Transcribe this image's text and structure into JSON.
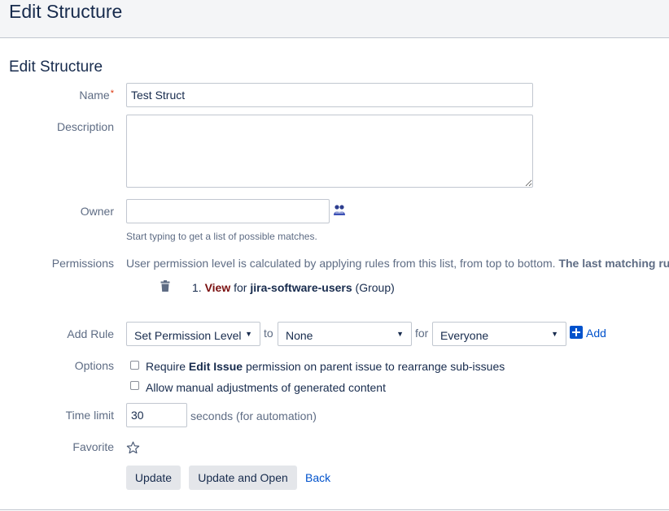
{
  "header": {
    "title": "Edit Structure"
  },
  "form": {
    "title": "Edit Structure",
    "name": {
      "label": "Name",
      "required_mark": "*",
      "value": "Test Struct"
    },
    "description": {
      "label": "Description",
      "value": ""
    },
    "owner": {
      "label": "Owner",
      "value": "",
      "hint": "Start typing to get a list of possible matches."
    },
    "permissions": {
      "label": "Permissions",
      "intro": "User permission level is calculated by applying rules from this list, from top to bottom. ",
      "intro_bold": "The last matching ru",
      "rules": [
        {
          "number": "1.",
          "level": "View",
          "for_text": " for ",
          "target": "jira-software-users",
          "type": " (Group)"
        }
      ]
    },
    "add_rule": {
      "label": "Add Rule",
      "action_select": "Set Permission Level",
      "to_text": "to",
      "level_select": "None",
      "for_text": "for",
      "who_select": "Everyone",
      "add_label": "Add"
    },
    "options": {
      "label": "Options",
      "items": [
        {
          "prefix": "Require ",
          "bold": "Edit Issue",
          "suffix": " permission on parent issue to rearrange sub-issues",
          "checked": false
        },
        {
          "prefix": "Allow manual adjustments of generated content",
          "bold": "",
          "suffix": "",
          "checked": false
        }
      ]
    },
    "time_limit": {
      "label": "Time limit",
      "value": "30",
      "suffix": "seconds (for automation)"
    },
    "favorite": {
      "label": "Favorite"
    },
    "buttons": {
      "update": "Update",
      "update_open": "Update and Open",
      "back": "Back"
    }
  },
  "colors": {
    "accent": "#0052cc",
    "level": "#7a1010",
    "label": "#5e6c84",
    "text": "#172b4d"
  }
}
